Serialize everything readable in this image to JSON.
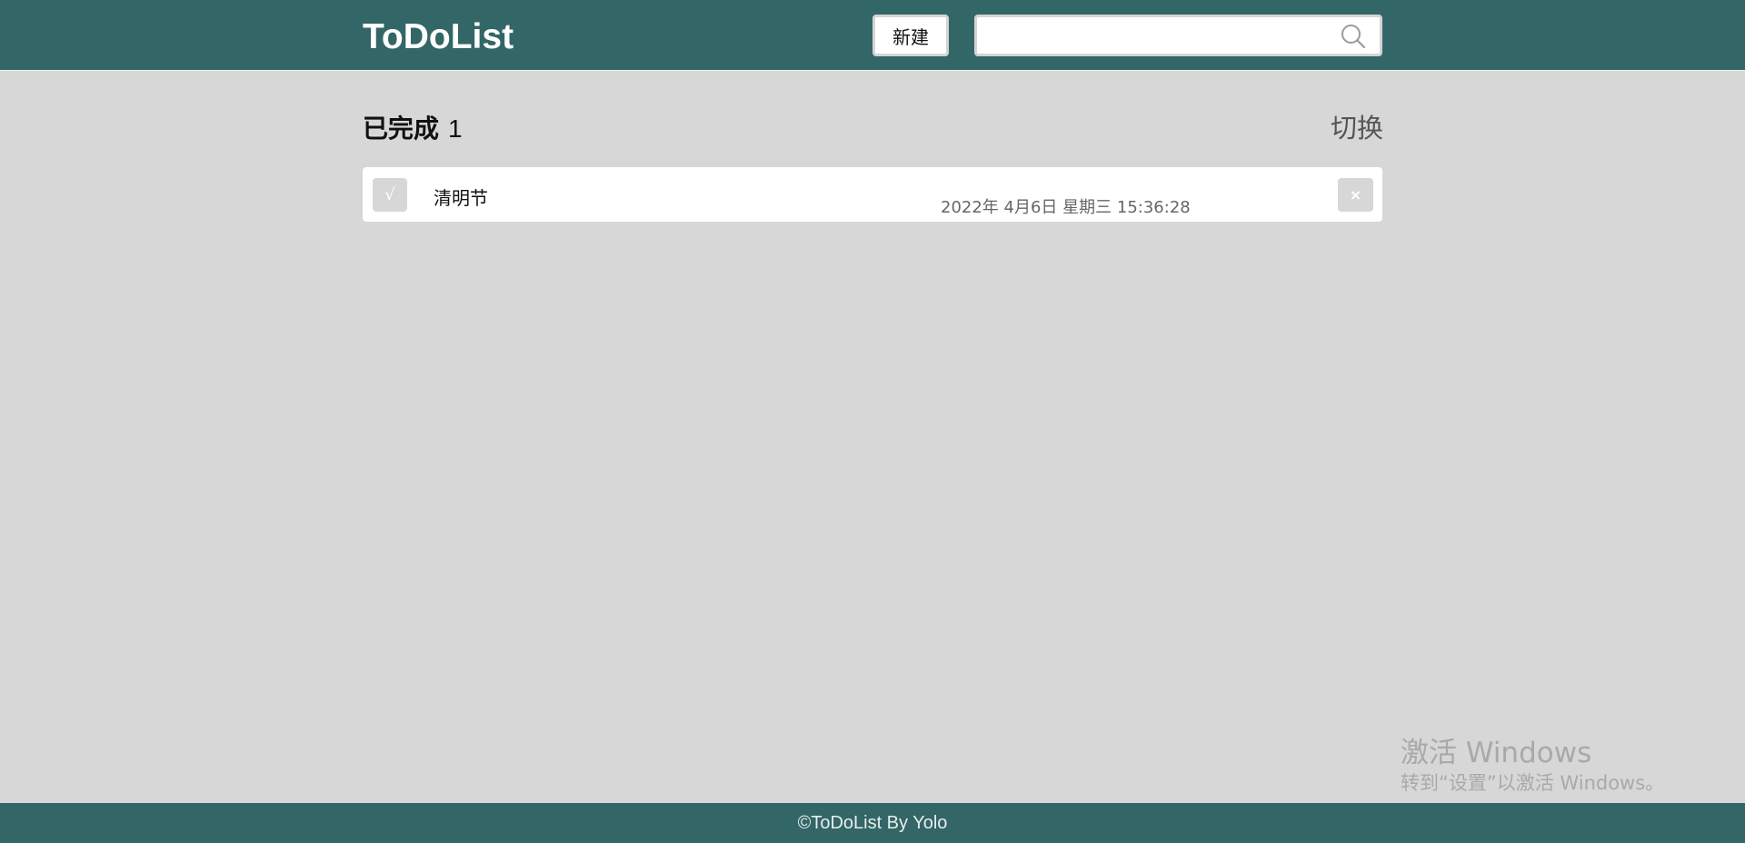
{
  "header": {
    "logo": "ToDoList",
    "new_button_label": "新建",
    "search_value": "",
    "search_placeholder": "",
    "search_icon": "search-icon"
  },
  "section": {
    "title": "已完成",
    "count": "1",
    "switch_label": "切换"
  },
  "todos": [
    {
      "check_symbol": "√",
      "title": "清明节",
      "time": "2022年 4月6日 星期三 15:36:28",
      "delete_symbol": "×",
      "completed": true
    }
  ],
  "watermark": {
    "title": "激活 Windows",
    "subtitle": "转到“设置”以激活 Windows。"
  },
  "footer": {
    "text": "©ToDoList By Yolo"
  },
  "colors": {
    "header_bg": "#336666",
    "page_bg": "#d7d7d7",
    "item_bg": "#ffffff",
    "button_gray": "#d7d7d7"
  }
}
